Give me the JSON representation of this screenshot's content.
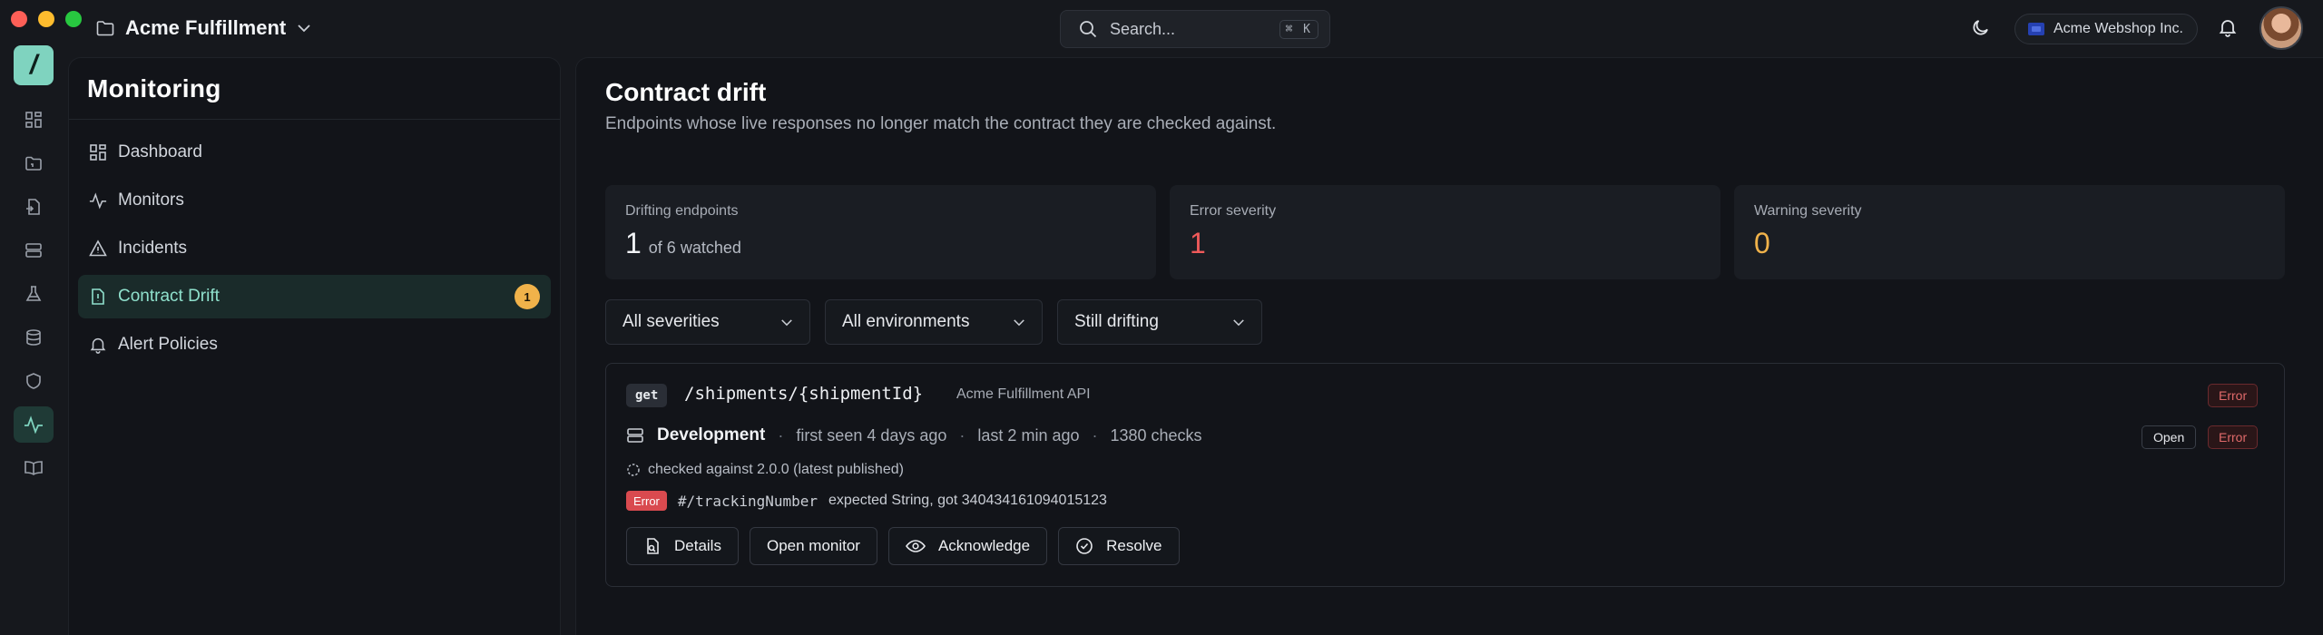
{
  "window": {
    "workspace_name": "Acme Fulfillment",
    "search_placeholder": "Search...",
    "search_shortcut": "⌘ K",
    "org_name": "Acme Webshop Inc."
  },
  "rail": {
    "logo_glyph": "/",
    "items": [
      {
        "icon": "dashboard-grid-icon"
      },
      {
        "icon": "folder-icon"
      },
      {
        "icon": "document-import-icon"
      },
      {
        "icon": "server-stack-icon"
      },
      {
        "icon": "flask-icon"
      },
      {
        "icon": "database-icon"
      },
      {
        "icon": "shield-icon"
      },
      {
        "icon": "activity-pulse-icon",
        "active": true
      },
      {
        "icon": "book-open-icon"
      }
    ]
  },
  "sidebar": {
    "title": "Monitoring",
    "items": [
      {
        "label": "Dashboard",
        "icon": "dashboard-grid-icon"
      },
      {
        "label": "Monitors",
        "icon": "activity-pulse-icon"
      },
      {
        "label": "Incidents",
        "icon": "warning-triangle-icon"
      },
      {
        "label": "Contract Drift",
        "icon": "file-alert-icon",
        "badge": "1",
        "active": true
      },
      {
        "label": "Alert Policies",
        "icon": "bell-icon"
      }
    ]
  },
  "main": {
    "title": "Contract drift",
    "subtitle": "Endpoints whose live responses no longer match the contract they are checked against.",
    "stats": [
      {
        "label": "Drifting endpoints",
        "value": "1",
        "suffix": "of 6 watched"
      },
      {
        "label": "Error severity",
        "value": "1"
      },
      {
        "label": "Warning severity",
        "value": "0"
      }
    ],
    "filters": {
      "severity": "All severities",
      "environment": "All environments",
      "status": "Still drifting"
    },
    "card": {
      "method": "get",
      "path": "/shipments/{shipmentId}",
      "api_name": "Acme Fulfillment API",
      "severity": "Error",
      "environment": "Development",
      "first_seen": "first seen 4 days ago",
      "last_seen": "last 2 min ago",
      "checks": "1380 checks",
      "status": "Open",
      "env_severity": "Error",
      "checked_against": "checked against 2.0.0 (latest published)",
      "error_chip": "Error",
      "pointer": "#/trackingNumber",
      "message": "expected String, got 340434161094015123",
      "actions": {
        "details": "Details",
        "open_monitor": "Open monitor",
        "acknowledge": "Acknowledge",
        "resolve": "Resolve"
      }
    }
  },
  "colors": {
    "accent_teal": "#7fd3bf",
    "error_red": "#f05a5a",
    "warning_amber": "#f0b24a"
  }
}
